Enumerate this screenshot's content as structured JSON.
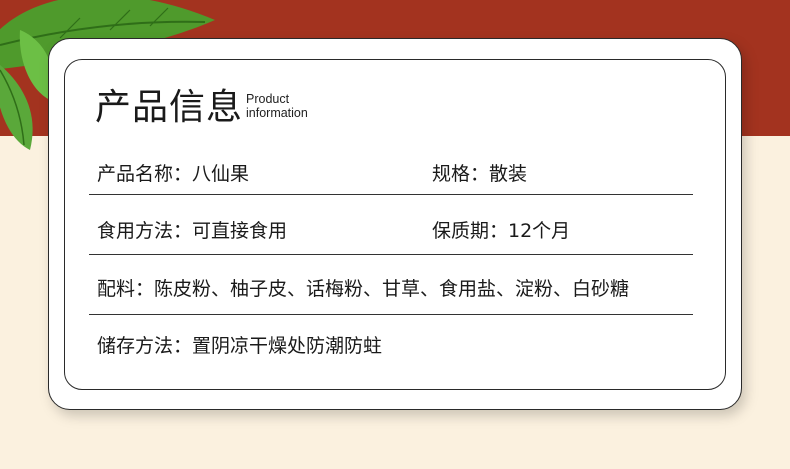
{
  "header": {
    "title_cn": "产品信息",
    "title_en_line1": "Product",
    "title_en_line2": "information"
  },
  "rows": [
    {
      "left": "产品名称：八仙果",
      "right": "规格：散装"
    },
    {
      "left": "食用方法：可直接食用",
      "right": "保质期：12个月"
    },
    {
      "left": "配料：陈皮粉、柚子皮、话梅粉、甘草、食用盐、淀粉、白砂糖"
    },
    {
      "left": "储存方法：置阴凉干燥处防潮防蛀"
    }
  ],
  "colors": {
    "band": "#a3331f",
    "background": "#fbf1df",
    "leaf": "#4f9a2c"
  }
}
